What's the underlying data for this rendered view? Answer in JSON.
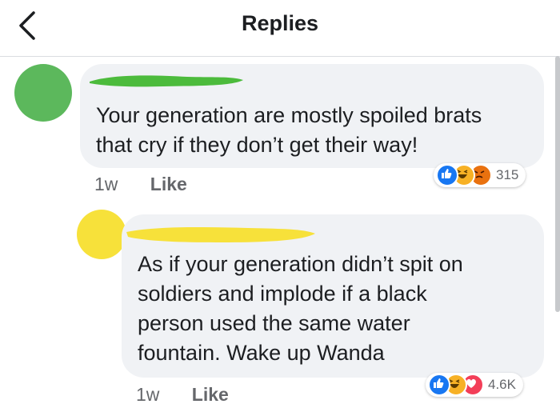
{
  "header": {
    "title": "Replies"
  },
  "comments": [
    {
      "text_line1": "Your generation are mostly spoiled brats",
      "text_line2": "that cry if they don’t get their way!",
      "time": "1w",
      "like_label": "Like",
      "reaction_count": "315",
      "reaction_icons": [
        "like-icon",
        "haha-icon",
        "angry-icon"
      ],
      "avatar_color": "#5cb85c",
      "name_redaction_color": "#4cbb3c"
    },
    {
      "text_line1": "As if your generation didn’t spit on",
      "text_line2": "soldiers and implode if a black",
      "text_line3": "person used the same water",
      "text_line4": "fountain. Wake up Wanda",
      "time": "1w",
      "like_label": "Like",
      "reaction_count": "4.6K",
      "reaction_icons": [
        "like-icon",
        "haha-icon",
        "love-icon"
      ],
      "avatar_color": "#f7e13a",
      "name_redaction_color": "#f7e13a"
    }
  ],
  "colors": {
    "bubble_bg": "#f0f2f5",
    "like_blue": "#1877f2",
    "haha_yellow": "#f7b125",
    "angry_orange": "#e9710f",
    "love_red": "#f33e58"
  }
}
